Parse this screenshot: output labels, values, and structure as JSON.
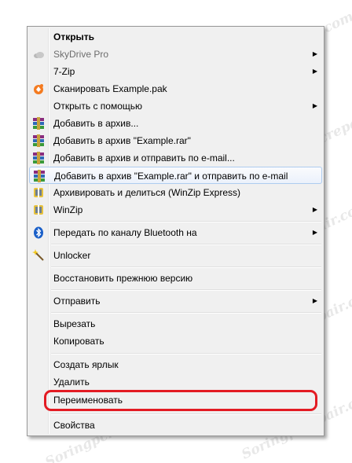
{
  "menu": {
    "items": [
      {
        "label": "Открыть",
        "bold": true,
        "icon": ""
      },
      {
        "label": "SkyDrive Pro",
        "disabled": true,
        "icon": "skydrive-cloud-icon",
        "submenu": true
      },
      {
        "label": "7-Zip",
        "icon": "",
        "submenu": true
      },
      {
        "label": "Сканировать Example.pak",
        "icon": "avast-icon"
      },
      {
        "label": "Открыть с помощью",
        "icon": "",
        "submenu": true
      },
      {
        "label": "Добавить в архив...",
        "icon": "winrar-icon"
      },
      {
        "label": "Добавить в архив \"Example.rar\"",
        "icon": "winrar-icon"
      },
      {
        "label": "Добавить в архив и отправить по e-mail...",
        "icon": "winrar-icon"
      },
      {
        "label": "Добавить в архив \"Example.rar\" и отправить по e-mail",
        "icon": "winrar-icon",
        "highlighted": true
      },
      {
        "label": "Архивировать и делиться (WinZip Express)",
        "icon": "winzip-icon"
      },
      {
        "label": "WinZip",
        "icon": "winzip-icon",
        "submenu": true
      },
      {
        "label": "Передать по каналу Bluetooth на",
        "icon": "bluetooth-icon",
        "submenu": true
      },
      {
        "label": "Unlocker",
        "icon": "unlocker-wand-icon"
      },
      {
        "label": "Восстановить прежнюю версию",
        "icon": ""
      },
      {
        "label": "Отправить",
        "icon": "",
        "submenu": true
      },
      {
        "label": "Вырезать",
        "icon": ""
      },
      {
        "label": "Копировать",
        "icon": ""
      },
      {
        "label": "Создать ярлык",
        "icon": ""
      },
      {
        "label": "Удалить",
        "icon": ""
      },
      {
        "label": "Переименовать",
        "icon": "",
        "outlined": true
      },
      {
        "label": "Свойства",
        "icon": ""
      }
    ],
    "submenu_arrow": "▶"
  },
  "watermark": {
    "text": "Soringpcrepair.com"
  },
  "colors": {
    "highlight_outline": "#e31b23",
    "menu_background": "#f0f0f0",
    "hover_border": "#aeccef"
  }
}
